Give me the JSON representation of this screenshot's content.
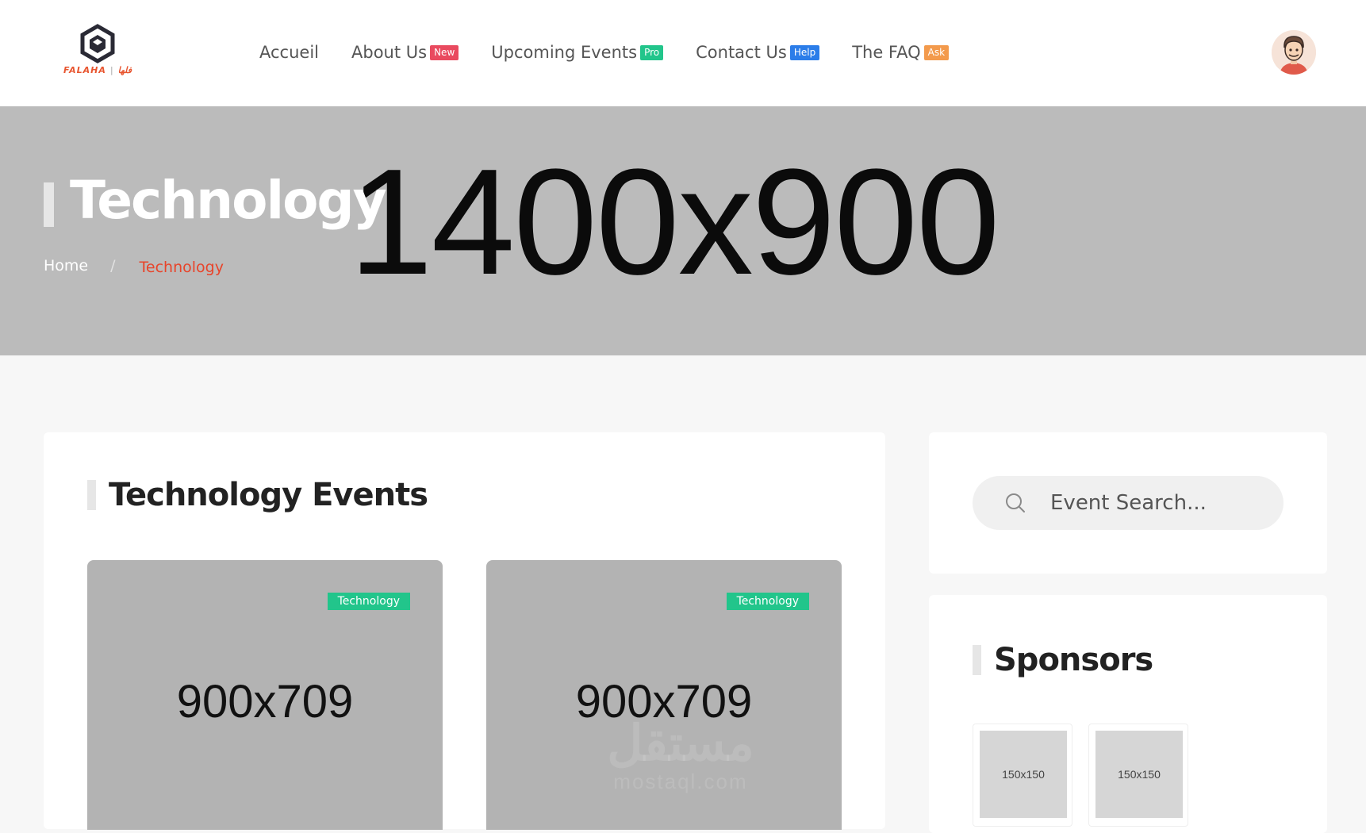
{
  "brand": {
    "name": "FALAHA",
    "arabic": "فلها"
  },
  "nav": [
    {
      "label": "Accueil",
      "badge": null,
      "badge_color": null
    },
    {
      "label": "About Us",
      "badge": "New",
      "badge_color": "#e94a5f"
    },
    {
      "label": "Upcoming Events",
      "badge": "Pro",
      "badge_color": "#22c58b"
    },
    {
      "label": "Contact Us",
      "badge": "Help",
      "badge_color": "#2b7de9"
    },
    {
      "label": "The FAQ",
      "badge": "Ask",
      "badge_color": "#f39a4c"
    }
  ],
  "hero": {
    "title": "Technology",
    "placeholder": "1400x900",
    "breadcrumb": {
      "home": "Home",
      "separator": "/",
      "current": "Technology"
    }
  },
  "main": {
    "section_title": "Technology Events",
    "events": [
      {
        "tag": "Technology",
        "placeholder": "900x709"
      },
      {
        "tag": "Technology",
        "placeholder": "900x709"
      }
    ],
    "watermark": {
      "arabic": "مستقل",
      "latin": "mostaql.com"
    }
  },
  "sidebar": {
    "search": {
      "placeholder": "Event Search..."
    },
    "sponsors": {
      "title": "Sponsors",
      "items": [
        {
          "label": "150x150"
        },
        {
          "label": "150x150"
        }
      ]
    }
  },
  "colors": {
    "accent": "#e8442a",
    "tag": "#22c58b",
    "hero_bg": "#bbbbbb"
  }
}
